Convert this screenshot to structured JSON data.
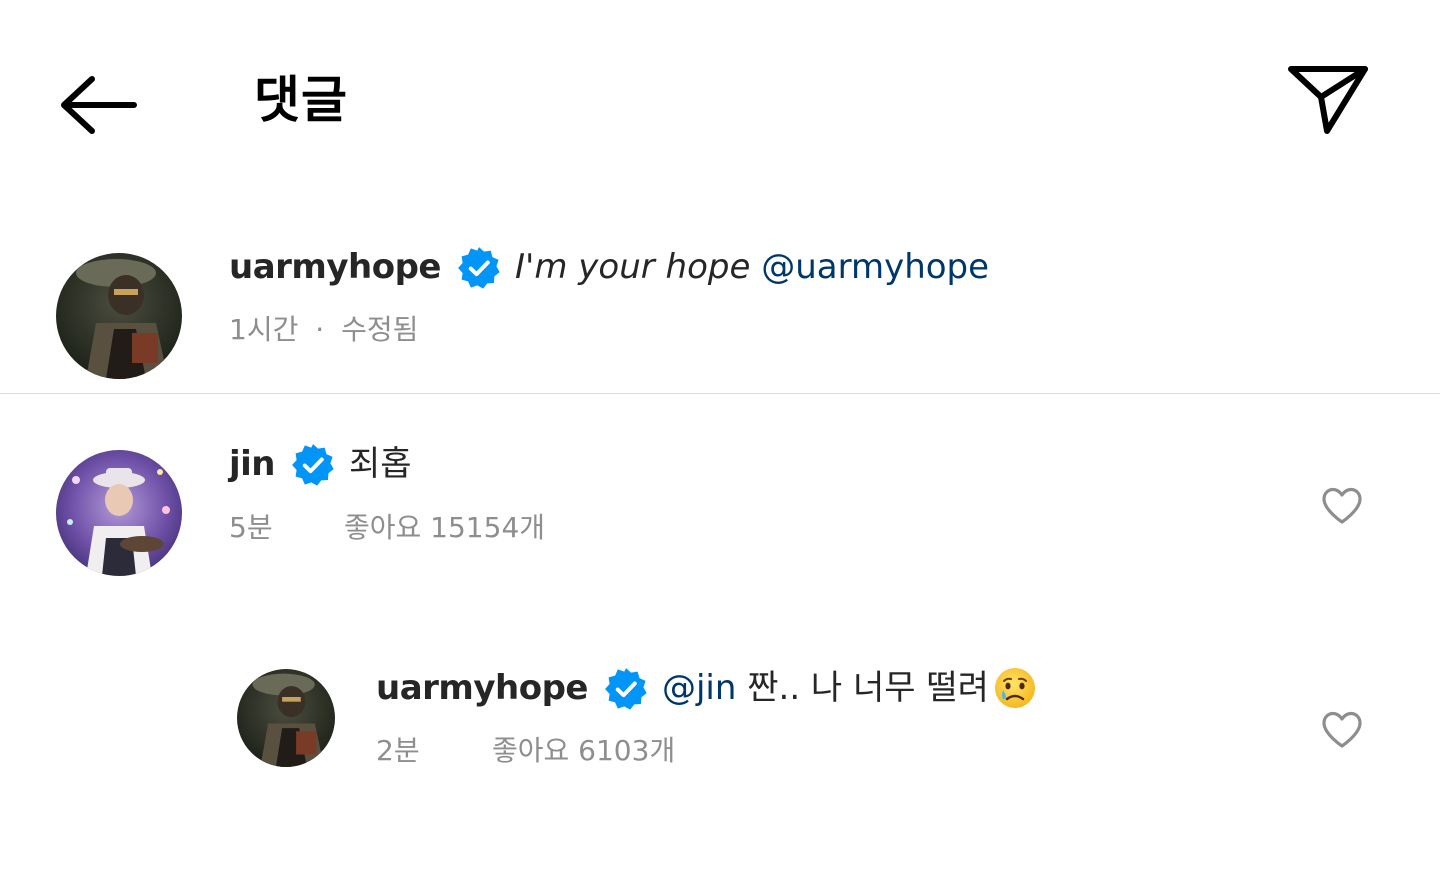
{
  "header": {
    "title": "댓글",
    "back_icon": "arrow-left-icon",
    "share_icon": "paper-plane-icon"
  },
  "caption": {
    "username": "uarmyhope",
    "verified": true,
    "text": "I'm your hope",
    "mention": "@uarmyhope",
    "time": "1시간",
    "separator": "·",
    "edited": "수정됨"
  },
  "comments": [
    {
      "username": "jin",
      "verified": true,
      "text": "죄홉",
      "time": "5분",
      "likes": "좋아요 15154개"
    }
  ],
  "replies": [
    {
      "username": "uarmyhope",
      "verified": true,
      "mention": "@jin",
      "text": "짠.. 나 너무 떨려",
      "emoji": "crying-face-emoji",
      "time": "2분",
      "likes": "좋아요 6103개"
    }
  ],
  "colors": {
    "verified_blue": "#0095f6",
    "mention_blue": "#00376b",
    "meta_gray": "#8e8e8e",
    "divider": "#dbdbdb"
  }
}
